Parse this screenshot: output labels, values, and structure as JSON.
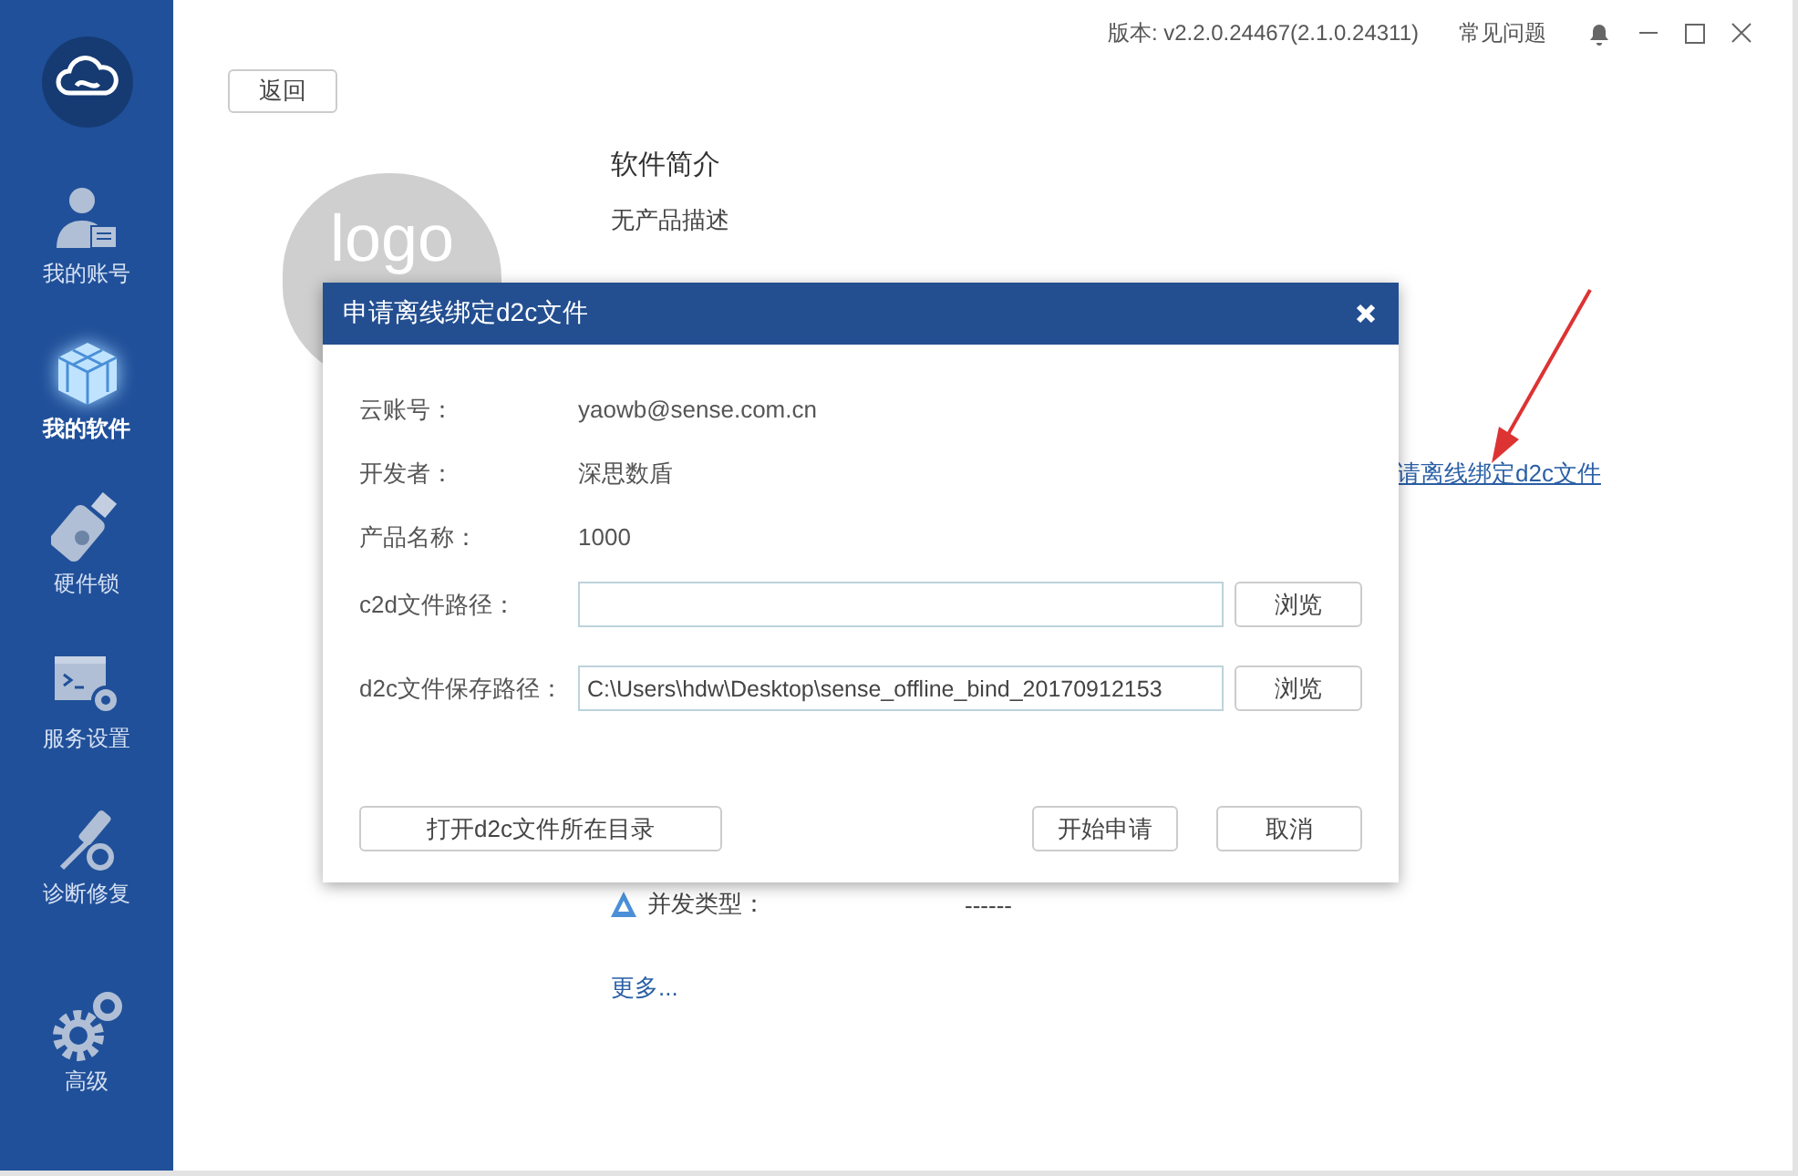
{
  "sidebar": {
    "items": [
      {
        "label": "我的账号",
        "kind": "account",
        "selected": false
      },
      {
        "label": "我的软件",
        "kind": "software",
        "selected": true
      },
      {
        "label": "硬件锁",
        "kind": "dongle",
        "selected": false
      },
      {
        "label": "服务设置",
        "kind": "service",
        "selected": false
      },
      {
        "label": "诊断修复",
        "kind": "repair",
        "selected": false
      }
    ],
    "footer_item": {
      "label": "高级",
      "kind": "advanced",
      "selected": false
    }
  },
  "top_bar": {
    "version": "版本: v2.2.0.24467(2.1.0.24311)",
    "faq": "常见问题"
  },
  "back_button": "返回",
  "product": {
    "logo_text": "logo",
    "intro_title": "软件简介",
    "intro_text": "无产品描述",
    "link": "请离线绑定d2c文件",
    "details": [
      {
        "label": "并发类型：",
        "value": "------"
      }
    ],
    "more_link": "更多..."
  },
  "dialog": {
    "title": "申请离线绑定d2c文件",
    "info_rows": [
      {
        "label": "云账号：",
        "value": "yaowb@sense.com.cn"
      },
      {
        "label": "开发者：",
        "value": "深思数盾"
      },
      {
        "label": "产品名称：",
        "value": "1000"
      }
    ],
    "path_fields": [
      {
        "label": "c2d文件路径：",
        "browse": "浏览"
      },
      {
        "label": "d2c文件保存路径：",
        "value": "C:\\Users\\hdw\\Desktop\\sense_offline_bind_20170912153",
        "browse": "浏览"
      }
    ],
    "open_dir_button": "打开d2c文件所在目录",
    "start_button": "开始申请",
    "cancel_button": "取消"
  }
}
